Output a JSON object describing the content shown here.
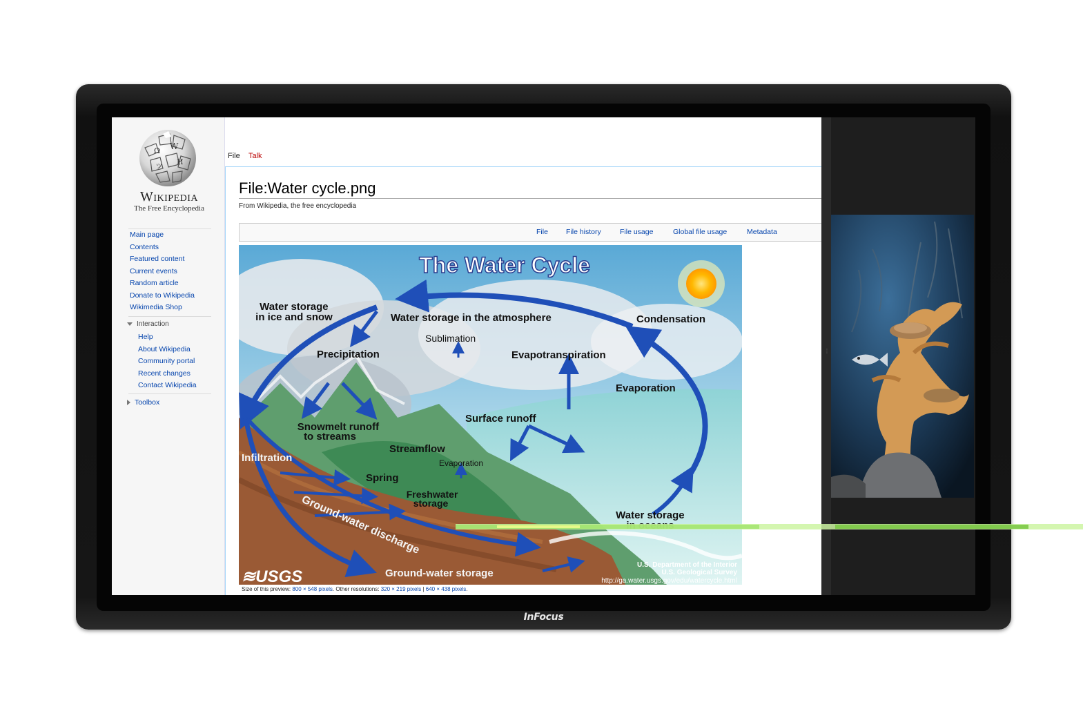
{
  "monitor": {
    "brand": "InFocus"
  },
  "wiki": {
    "logo": {
      "title": "Wikipedia",
      "subtitle": "The Free Encyclopedia"
    },
    "nav_main": [
      "Main page",
      "Contents",
      "Featured content",
      "Current events",
      "Random article",
      "Donate to Wikipedia",
      "Wikimedia Shop"
    ],
    "interaction": {
      "heading": "Interaction",
      "items": [
        "Help",
        "About Wikipedia",
        "Community portal",
        "Recent changes",
        "Contact Wikipedia"
      ]
    },
    "toolbox": "Toolbox",
    "tabs": {
      "file": "File",
      "talk": "Talk"
    },
    "page_title": "File:Water cycle.png",
    "tagline": "From Wikipedia, the free encyclopedia",
    "filetoc": [
      "File",
      "File history",
      "File usage",
      "Global file usage",
      "Metadata"
    ],
    "preview": {
      "prefix": "Size of this preview:",
      "size": "800 × 548 pixels",
      "other": ". Other resolutions:",
      "res1": "320 × 219 pixels",
      "sep": "|",
      "res2": "640 × 438 pixels",
      "suffix": "."
    },
    "diagram": {
      "title": "The Water Cycle",
      "labels": {
        "ice": "Water storage\nin ice and snow",
        "atmosphere": "Water storage in the atmosphere",
        "condensation": "Condensation",
        "sublimation": "Sublimation",
        "precipitation": "Precipitation",
        "evapotranspiration": "Evapotranspiration",
        "evaporation": "Evaporation",
        "snowmelt": "Snowmelt runoff\nto streams",
        "surface_runoff": "Surface runoff",
        "streamflow": "Streamflow",
        "evaporation_small": "Evaporation",
        "infiltration": "Infiltration",
        "spring": "Spring",
        "freshwater": "Freshwater\nstorage",
        "gw_discharge": "Ground-water discharge",
        "oceans": "Water storage\nin oceans",
        "gw_storage": "Ground-water storage",
        "usgs": "USGS",
        "dept": "U.S. Department of the Interior",
        "survey": "U.S. Geological Survey",
        "url": "http://ga.water.usgs.gov/edu/watercycle.html"
      }
    }
  },
  "colors": {
    "link": "#0645ad",
    "talk": "#ba0000",
    "bezel": "#161616"
  }
}
